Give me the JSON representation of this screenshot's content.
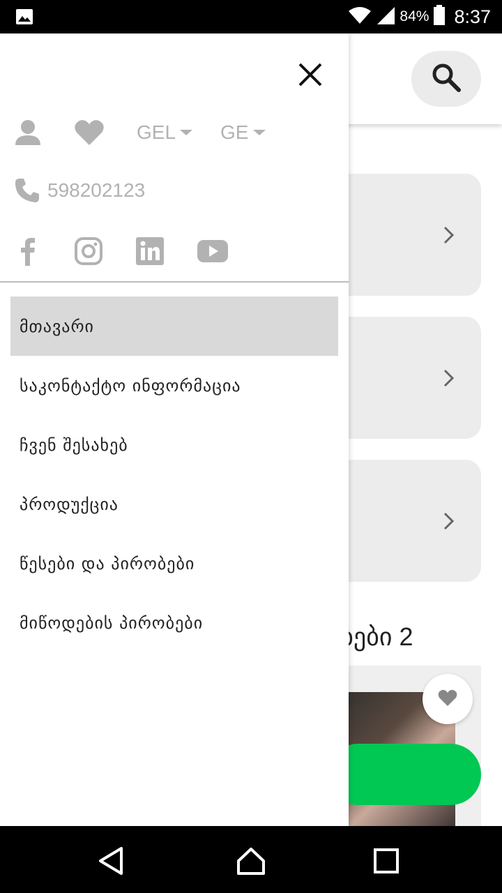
{
  "status_bar": {
    "battery": "84%",
    "time": "8:37",
    "icons": [
      "gallery-icon",
      "wifi-icon",
      "signal-icon",
      "battery-icon"
    ]
  },
  "background": {
    "section_title": "ებები 2",
    "accent_color": "#00c853",
    "card_color": "#ececec"
  },
  "drawer": {
    "currency": "GEL",
    "language": "GE",
    "phone": "598202123",
    "social": [
      "facebook-icon",
      "instagram-icon",
      "linkedin-icon",
      "youtube-icon"
    ],
    "menu": [
      {
        "label": "მთავარი",
        "active": true
      },
      {
        "label": "საკონტაქტო ინფორმაცია",
        "active": false
      },
      {
        "label": "ჩვენ შესახებ",
        "active": false
      },
      {
        "label": "პროდუქცია",
        "active": false
      },
      {
        "label": "წესები და პირობები",
        "active": false
      },
      {
        "label": "მიწოდების პირობები",
        "active": false
      }
    ],
    "icon_color": "#b2b2b2",
    "active_bg": "#d9d9d9"
  },
  "nav_bar": {
    "buttons": [
      "back-icon",
      "home-icon",
      "recents-icon"
    ]
  }
}
